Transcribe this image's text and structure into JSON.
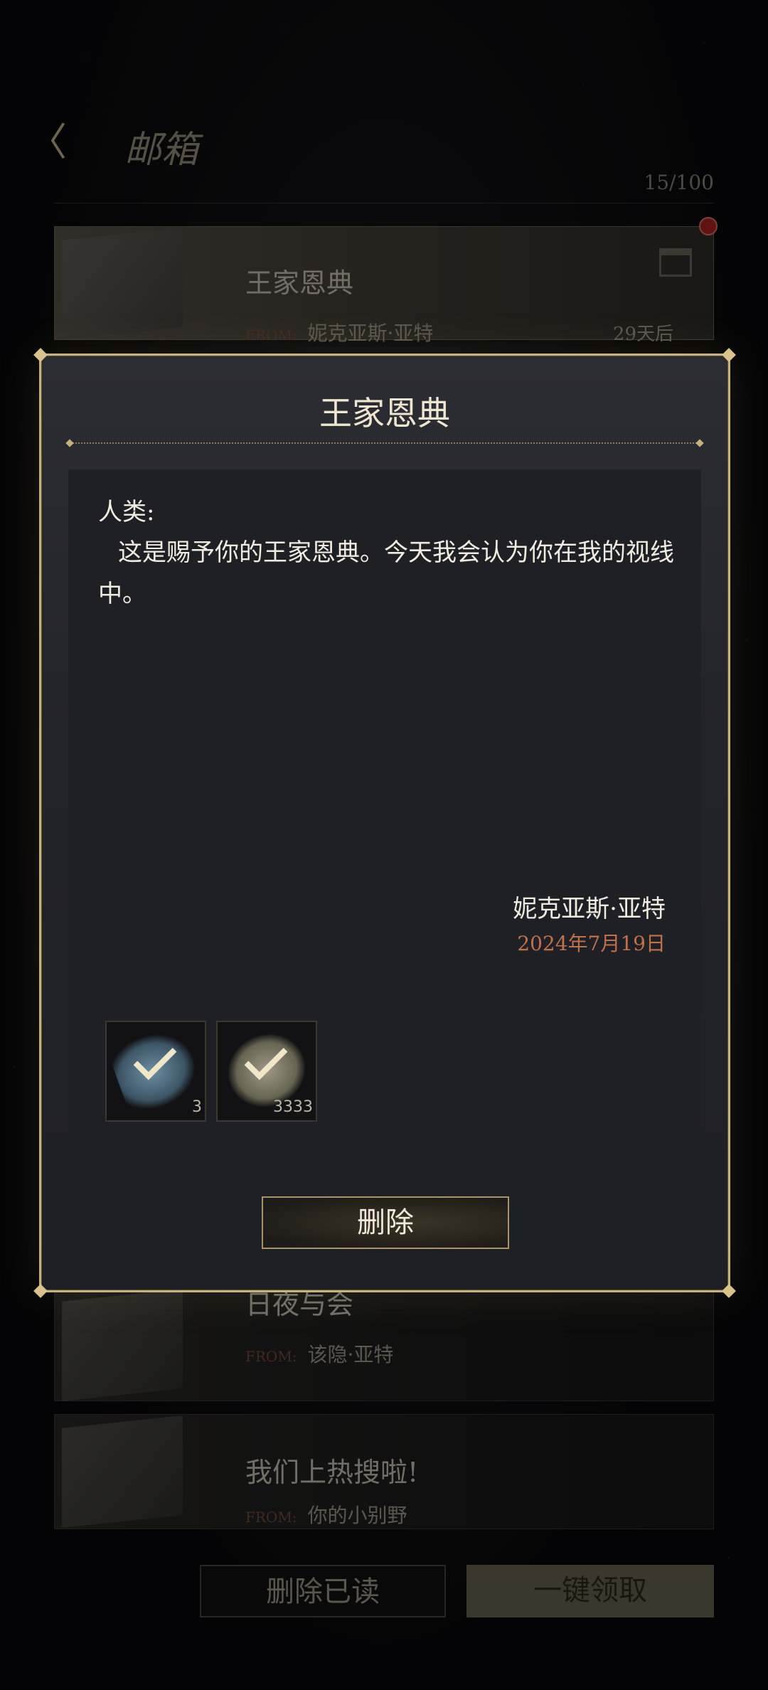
{
  "header": {
    "back_icon": "back-arrow-icon",
    "title": "邮箱",
    "mail_count": "15/100"
  },
  "mail_list": [
    {
      "title": "王家恩典",
      "from_label": "FROM:",
      "from": "妮克亚斯·亚特",
      "expire": "29天后",
      "unread": true,
      "has_gift": true
    },
    {
      "title": "日夜与会",
      "from_label": "FROM:",
      "from": "该隐·亚特"
    },
    {
      "title": "我们上热搜啦!",
      "from_label": "FROM:",
      "from": "你的小别野"
    }
  ],
  "bottom_buttons": {
    "delete_read": "删除已读",
    "claim_all": "一键领取"
  },
  "modal": {
    "title": "王家恩典",
    "salutation": "人类:",
    "body": "这是赐予你的王家恩典。今天我会认为你在我的视线中。",
    "signature": "妮克亚斯·亚特",
    "date": "2024年7月19日",
    "attachments": [
      {
        "icon": "feather-icon",
        "quantity": "3",
        "claimed": true
      },
      {
        "icon": "coin-icon",
        "quantity": "3333",
        "claimed": true
      }
    ],
    "delete_label": "删除"
  },
  "colors": {
    "frame_gold": "#c8b27c",
    "date_accent": "#c0714a",
    "unread_dot": "#b32222"
  }
}
